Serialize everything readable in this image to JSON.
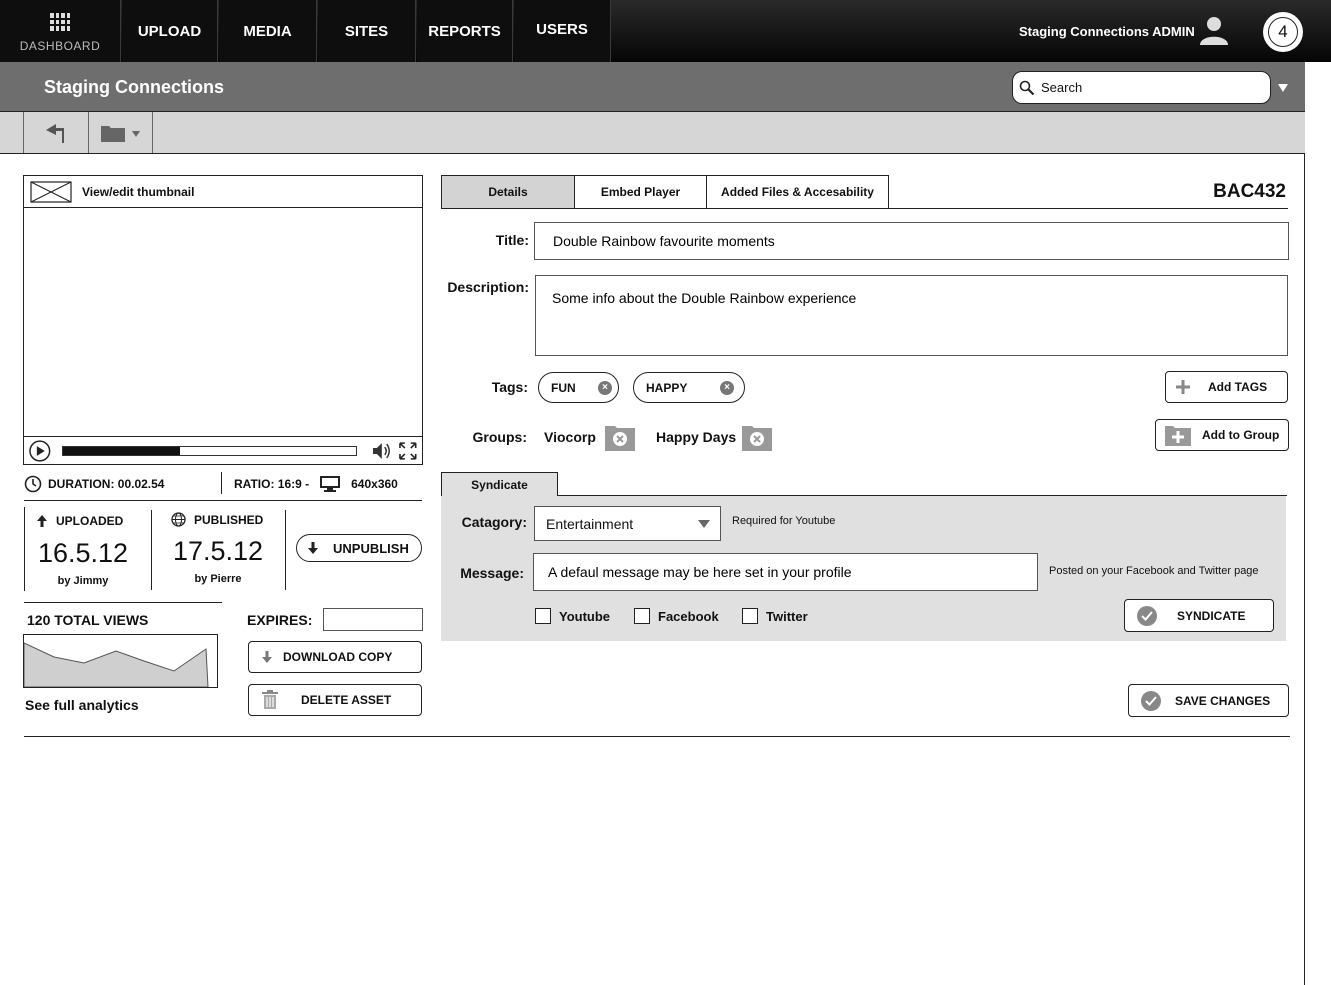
{
  "nav": {
    "dashboard": "DASHBOARD",
    "items": [
      "UPLOAD",
      "MEDIA",
      "SITES",
      "REPORTS",
      "USERS"
    ],
    "admin_name": "Staging Connections ADMIN",
    "notification_count": "4"
  },
  "header": {
    "site_title": "Staging Connections",
    "search_placeholder": "Search"
  },
  "player": {
    "thumbnail_label": "View/edit thumbnail",
    "progress_fraction": 0.4
  },
  "meta": {
    "duration": "DURATION: 00.02.54",
    "ratio": "RATIO: 16:9 -",
    "resolution": "640x360",
    "uploaded_label": "UPLOADED",
    "uploaded_date": "16.5.12",
    "uploaded_by": "by Jimmy",
    "published_label": "PUBLISHED",
    "published_date": "17.5.12",
    "published_by": "by Pierre",
    "unpublish": "UNPUBLISH",
    "views": "120 TOTAL VIEWS",
    "expires_label": "EXPIRES:",
    "expires_value": "",
    "download": "DOWNLOAD COPY",
    "delete": "DELETE ASSET",
    "analytics_link": "See full analytics"
  },
  "details": {
    "tabs": [
      "Details",
      "Embed Player",
      "Added Files & Accesability"
    ],
    "asset_id": "BAC432",
    "title_label": "Title:",
    "title_value": "Double Rainbow favourite moments",
    "description_label": "Description:",
    "description_value": "Some info about the Double Rainbow experience",
    "tags_label": "Tags:",
    "tags": [
      "FUN",
      "HAPPY"
    ],
    "add_tags": "Add TAGS",
    "groups_label": "Groups:",
    "groups": [
      "Viocorp",
      "Happy Days"
    ],
    "add_group": "Add to Group"
  },
  "syndicate": {
    "tab": "Syndicate",
    "category_label": "Catagory:",
    "category_value": "Entertainment",
    "category_note": "Required for Youtube",
    "message_label": "Message:",
    "message_value": "A defaul message may be here set in your profile",
    "message_note": "Posted on your Facebook and Twitter page",
    "channels": [
      "Youtube",
      "Facebook",
      "Twitter"
    ],
    "syndicate_button": "SYNDICATE"
  },
  "save_button": "SAVE CHANGES"
}
